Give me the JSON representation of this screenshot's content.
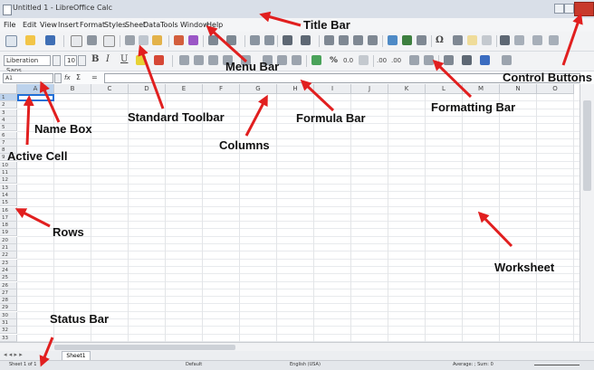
{
  "window": {
    "title": "Untitled 1 - LibreOffice Calc"
  },
  "menubar": {
    "items": [
      "File",
      "Edit",
      "View",
      "Insert",
      "Format",
      "Styles",
      "Sheet",
      "Data",
      "Tools",
      "Window",
      "Help"
    ]
  },
  "formatting": {
    "font_name": "Liberation Sans",
    "font_size": "10",
    "number_format_symbols": [
      "%",
      "0.0",
      ".00",
      ".00"
    ]
  },
  "formula_bar": {
    "cell_reference": "A1",
    "function_wizard": "fx",
    "sum_symbol": "Σ",
    "equals": "="
  },
  "sheet": {
    "columns": [
      "A",
      "B",
      "C",
      "D",
      "E",
      "F",
      "G",
      "H",
      "I",
      "J",
      "K",
      "L",
      "M",
      "N",
      "O"
    ],
    "rows": [
      "1",
      "2",
      "3",
      "4",
      "5",
      "6",
      "7",
      "8",
      "9",
      "10",
      "11",
      "12",
      "13",
      "14",
      "15",
      "16",
      "17",
      "18",
      "19",
      "20",
      "21",
      "22",
      "23",
      "24",
      "25",
      "26",
      "27",
      "28",
      "29",
      "30",
      "31",
      "32",
      "33"
    ],
    "tab": "Sheet1"
  },
  "statusbar": {
    "sheet_info": "Sheet 1 of 1",
    "page_style": "Default",
    "language": "English (USA)",
    "sum": "Average: ; Sum: 0"
  },
  "annotations": {
    "title_bar": "Title Bar",
    "menu_bar": "Menu Bar",
    "control_buttons": "Control Buttons",
    "name_box": "Name Box",
    "standard_toolbar": "Standard Toolbar",
    "formula_bar": "Formula Bar",
    "formatting_bar": "Formatting Bar",
    "active_cell": "Active Cell",
    "columns": "Columns",
    "rows": "Rows",
    "worksheet": "Worksheet",
    "status_bar": "Status Bar"
  },
  "colors": {
    "arrow": "#e11f1f",
    "active_cell": "#1f6fd8",
    "title_bg": "#d9dfe8"
  }
}
